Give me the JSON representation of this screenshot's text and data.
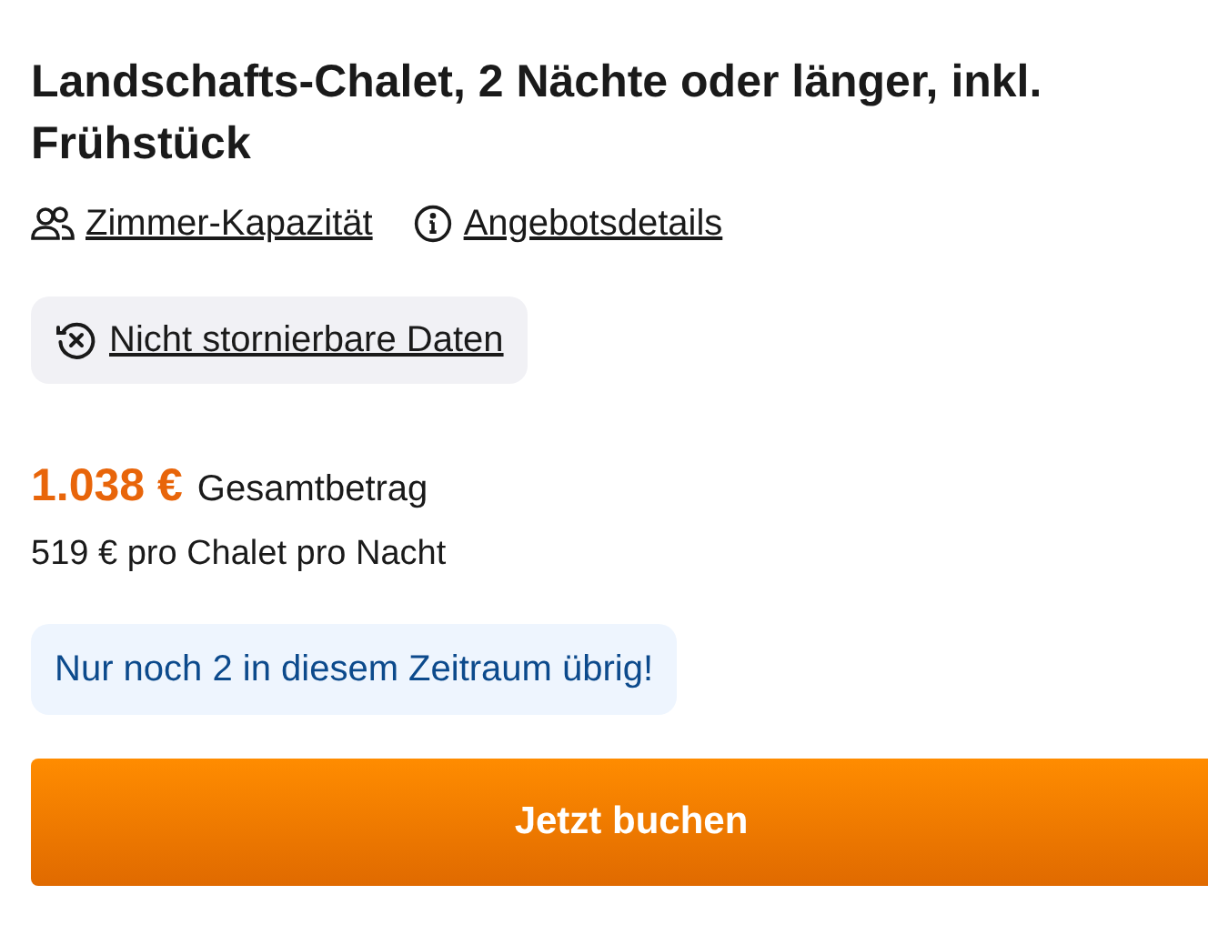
{
  "title": "Landschafts-Chalet, 2 Nächte oder länger, inkl. Frühstück",
  "links": [
    {
      "kind": "people",
      "label": "Zimmer-Kapazität"
    },
    {
      "kind": "info",
      "label": "Angebotsdetails"
    }
  ],
  "policy": {
    "kind": "non_refundable",
    "label": "Nicht stornierbare Daten"
  },
  "price": {
    "total": "1.038 €",
    "total_label": "Gesamtbetrag",
    "per_night": "519 € pro Chalet pro Nacht"
  },
  "availability": "Nur noch 2 in diesem Zeitraum übrig!",
  "button": "Jetzt buchen"
}
